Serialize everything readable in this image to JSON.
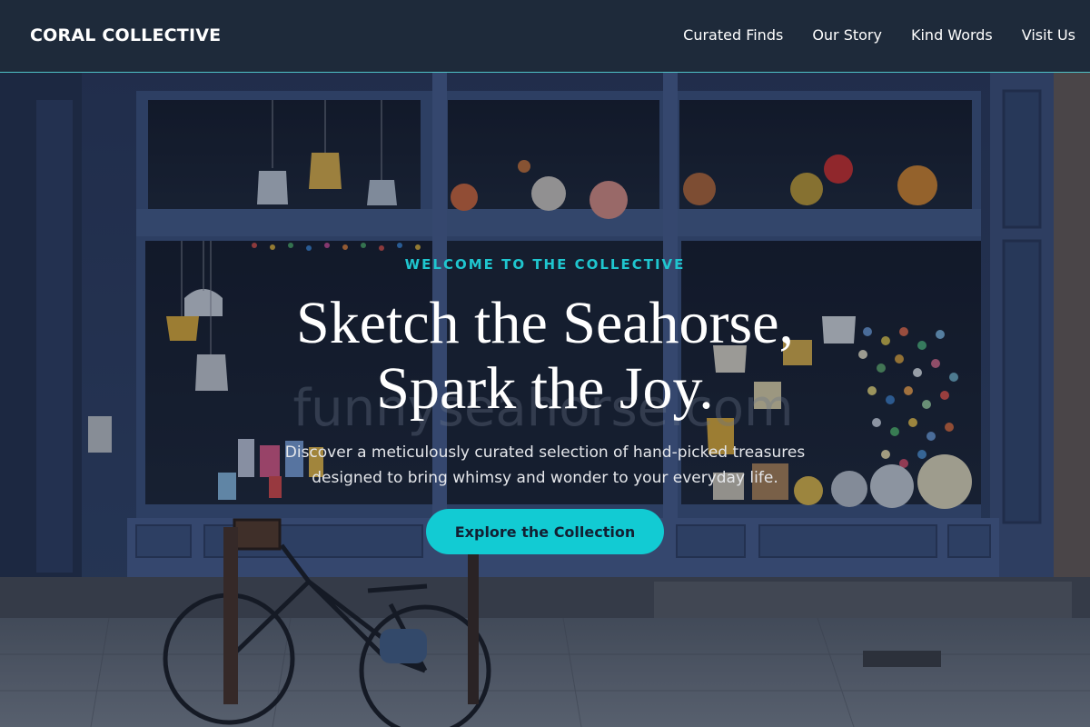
{
  "brand": {
    "name": "CORAL COLLECTIVE"
  },
  "nav": {
    "links": [
      "Curated Finds",
      "Our Story",
      "Kind Words",
      "Visit Us"
    ]
  },
  "hero": {
    "eyebrow": "WELCOME TO THE COLLECTIVE",
    "headline_line1": "Sketch the Seahorse,",
    "headline_line2": "Spark the Joy.",
    "subtext": "Discover a meticulously curated selection of hand-picked treasures designed to bring whimsy and wonder to your everyday life.",
    "cta_label": "Explore the Collection",
    "window_watermark": "funnyseahorse.com"
  },
  "colors": {
    "nav_bg": "#1e2a3a",
    "accent": "#12cbd3",
    "shopfront": "#3b4f78",
    "text": "#ffffff"
  }
}
